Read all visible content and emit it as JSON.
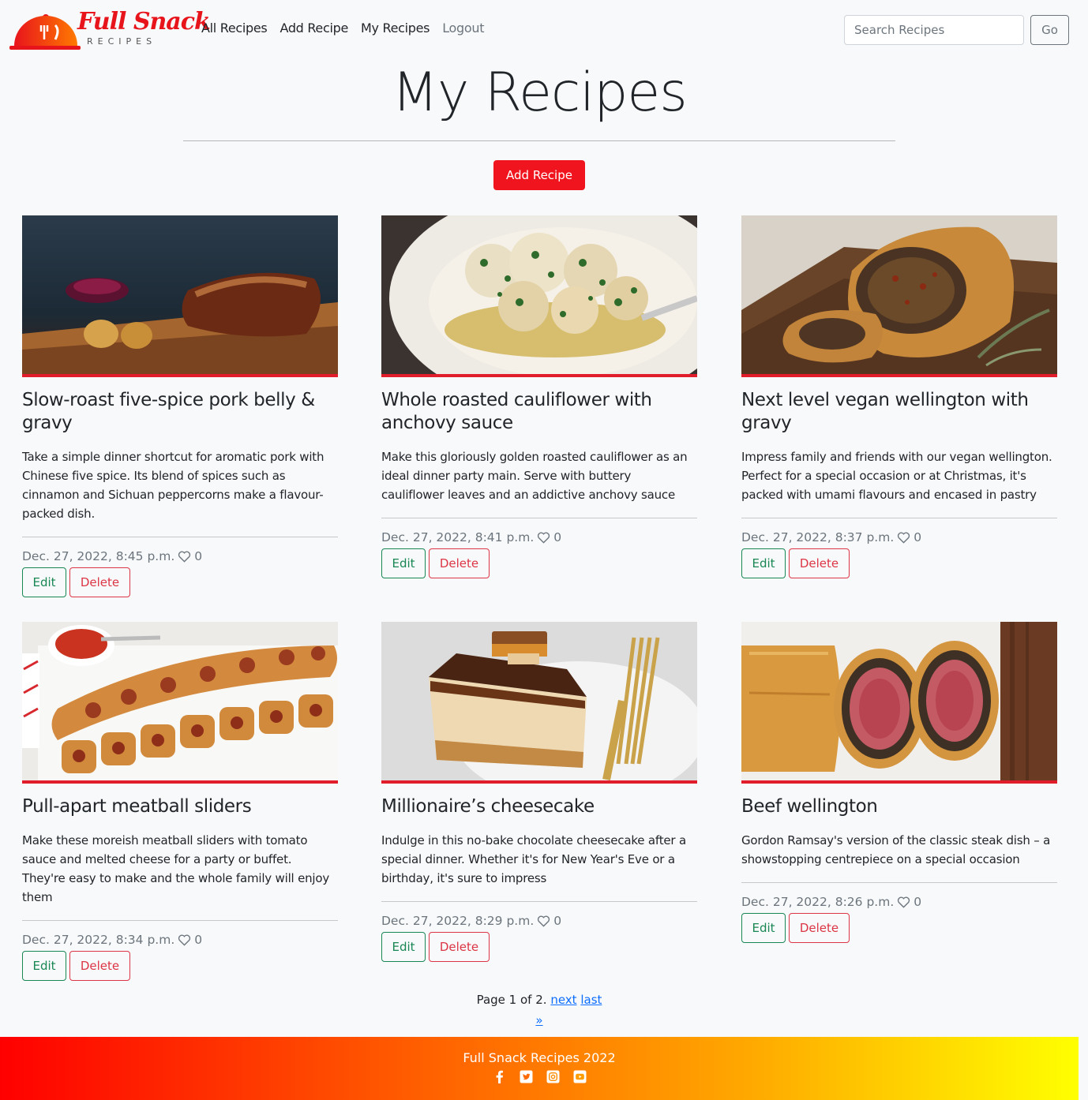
{
  "brand": {
    "name": "Full Snack",
    "tagline": "RECIPES",
    "color": "#e8141c"
  },
  "nav": {
    "links": [
      {
        "label": "All Recipes"
      },
      {
        "label": "Add Recipe"
      },
      {
        "label": "My Recipes"
      },
      {
        "label": "Logout"
      }
    ],
    "search_placeholder": "Search Recipes",
    "search_value": "",
    "go_label": "Go"
  },
  "page": {
    "title": "My Recipes",
    "add_button": "Add Recipe",
    "accent": "#f0141e"
  },
  "recipes": [
    {
      "title": "Slow-roast five-spice pork belly & gravy",
      "description": "Take a simple dinner shortcut for aromatic pork with Chinese five spice. Its blend of spices such as cinnamon and Sichuan peppercorns make a flavour-packed dish.",
      "date": "Dec. 27, 2022, 8:45 p.m.",
      "likes": "0",
      "edit": "Edit",
      "delete": "Delete"
    },
    {
      "title": "Whole roasted cauliflower with anchovy sauce",
      "description": "Make this gloriously golden roasted cauliflower as an ideal dinner party main. Serve with buttery cauliflower leaves and an addictive anchovy sauce",
      "date": "Dec. 27, 2022, 8:41 p.m.",
      "likes": "0",
      "edit": "Edit",
      "delete": "Delete"
    },
    {
      "title": "Next level vegan wellington with gravy",
      "description": "Impress family and friends with our vegan wellington. Perfect for a special occasion or at Christmas, it's packed with umami flavours and encased in pastry",
      "date": "Dec. 27, 2022, 8:37 p.m.",
      "likes": "0",
      "edit": "Edit",
      "delete": "Delete"
    },
    {
      "title": "Pull-apart meatball sliders",
      "description": "Make these moreish meatball sliders with tomato sauce and melted cheese for a party or buffet. They're easy to make and the whole family will enjoy them",
      "date": "Dec. 27, 2022, 8:34 p.m.",
      "likes": "0",
      "edit": "Edit",
      "delete": "Delete"
    },
    {
      "title": "Millionaire’s cheesecake",
      "description": "Indulge in this no-bake chocolate cheesecake after a special dinner. Whether it's for New Year's Eve or a birthday, it's sure to impress",
      "date": "Dec. 27, 2022, 8:29 p.m.",
      "likes": "0",
      "edit": "Edit",
      "delete": "Delete"
    },
    {
      "title": "Beef wellington",
      "description": "Gordon Ramsay's version of the classic steak dish – a showstopping centrepiece on a special occasion",
      "date": "Dec. 27, 2022, 8:26 p.m.",
      "likes": "0",
      "edit": "Edit",
      "delete": "Delete"
    }
  ],
  "pagination": {
    "text": "Page 1 of 2.",
    "next": "next",
    "last": "last",
    "raquo": "»"
  },
  "footer": {
    "text": "Full Snack Recipes 2022",
    "icons": [
      "facebook-icon",
      "twitter-icon",
      "instagram-icon",
      "youtube-icon"
    ]
  }
}
